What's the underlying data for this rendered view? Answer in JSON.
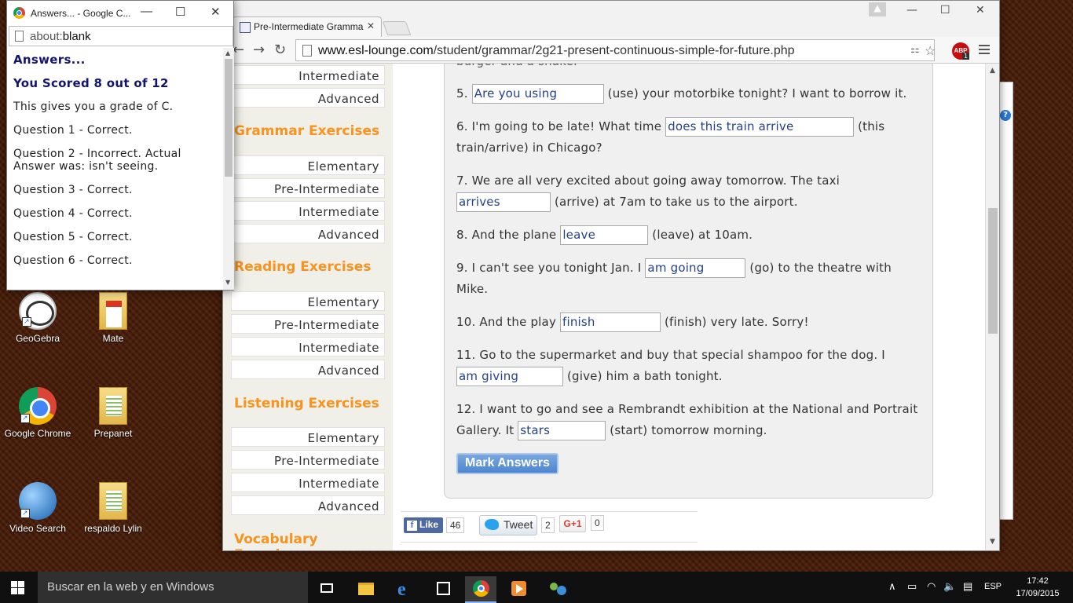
{
  "desktop": {
    "icons": [
      {
        "label": "GeoGebra"
      },
      {
        "label": "Mate"
      },
      {
        "label": "Google Chrome"
      },
      {
        "label": "Prepanet"
      },
      {
        "label": "Video Search"
      },
      {
        "label": "respaldo Lylin"
      }
    ]
  },
  "popup": {
    "title": "Answers... - Google C...",
    "url_prefix": "about:",
    "url_host": "blank",
    "heading": "Answers...",
    "score": "You Scored 8 out of 12",
    "grade": "This gives you a grade of C.",
    "results": [
      "Question 1 - Correct.",
      "Question 2 - Incorrect. Actual Answer was: isn't seeing.",
      "Question 3 - Correct.",
      "Question 4 - Correct.",
      "Question 5 - Correct.",
      "Question 6 - Correct."
    ]
  },
  "browser": {
    "tab_title": "Pre-Intermediate Gramma",
    "url_host": "www.esl-lounge.com",
    "url_path": "/student/grammar/2g21-present-continuous-simple-for-future.php",
    "abp_label": "ABP",
    "abp_count": "1"
  },
  "leftnav": {
    "top_items": [
      "Intermediate",
      "Advanced"
    ],
    "sections": [
      {
        "title": "Grammar Exercises",
        "items": [
          "Elementary",
          "Pre-Intermediate",
          "Intermediate",
          "Advanced"
        ]
      },
      {
        "title": "Reading Exercises",
        "items": [
          "Elementary",
          "Pre-Intermediate",
          "Intermediate",
          "Advanced"
        ]
      },
      {
        "title": "Listening Exercises",
        "items": [
          "Elementary",
          "Pre-Intermediate",
          "Intermediate",
          "Advanced"
        ]
      },
      {
        "title": "Vocabulary Exercises"
      }
    ]
  },
  "exercise": {
    "partial_top": "burger and a shake.",
    "questions": [
      {
        "before": "5. ",
        "answer": "Are you using",
        "after": " (use) your motorbike tonight? I want to borrow it."
      },
      {
        "before": "6. I'm going to be late! What time ",
        "answer": "does this train arrive",
        "after": " (this train/arrive) in Chicago?"
      },
      {
        "before": "7. We are all very excited about going away tomorrow. The taxi ",
        "answer": "arrives",
        "after": " (arrive) at 7am to take us to the airport."
      },
      {
        "before": "8. And the plane ",
        "answer": "leave",
        "after": " (leave) at 10am."
      },
      {
        "before": "9. I can't see you tonight Jan. I ",
        "answer": "am going",
        "after": " (go) to the theatre with Mike."
      },
      {
        "before": "10. And the play ",
        "answer": "finish",
        "after": " (finish) very late. Sorry!"
      },
      {
        "before": "11. Go to the supermarket and buy that special shampoo for the dog. I ",
        "answer": "am giving",
        "after": " (give) him a bath tonight."
      },
      {
        "before": "12. I want to go and see a Rembrandt exhibition at the National and Portrait Gallery. It ",
        "answer": "stars",
        "after": " (start) tomorrow morning."
      }
    ],
    "mark_button": "Mark Answers"
  },
  "social": {
    "like_label": "Like",
    "like_count": "46",
    "tweet_label": "Tweet",
    "tweet_count": "2",
    "gplus_label": "G+1",
    "gplus_count": "0"
  },
  "taskbar": {
    "search_placeholder": "Buscar en la web y en Windows",
    "language": "ESP",
    "time": "17:42",
    "date": "17/09/2015"
  }
}
